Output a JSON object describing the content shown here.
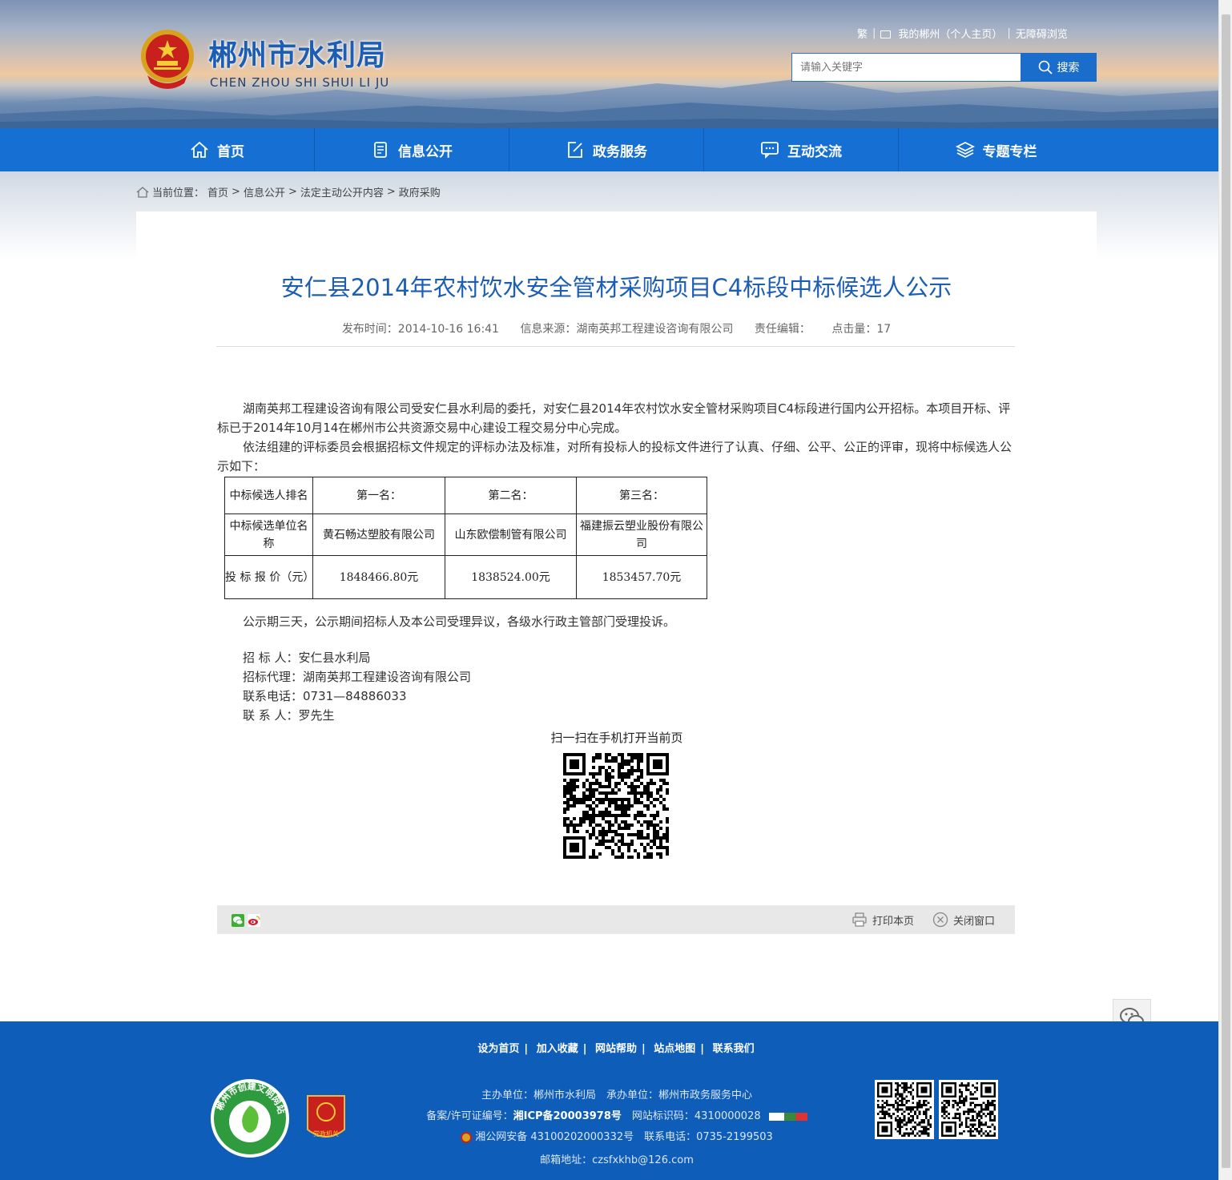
{
  "header": {
    "site_title": "郴州市水利局",
    "site_subtitle": "CHEN ZHOU SHI SHUI LI JU",
    "links": [
      "繁",
      "我的郴州（个人主页）",
      "无障碍浏览"
    ],
    "search_placeholder": "请输入关键字",
    "search_button": "搜索"
  },
  "nav": [
    {
      "label": "首页",
      "icon": "home-icon"
    },
    {
      "label": "信息公开",
      "icon": "document-icon"
    },
    {
      "label": "政务服务",
      "icon": "edit-icon"
    },
    {
      "label": "互动交流",
      "icon": "chat-icon"
    },
    {
      "label": "专题专栏",
      "icon": "layers-icon"
    }
  ],
  "breadcrumb": {
    "prefix": "当前位置：",
    "items": [
      "首页",
      "信息公开",
      "法定主动公开内容",
      "政府采购"
    ],
    "sep": ">"
  },
  "article": {
    "title": "安仁县2014年农村饮水安全管材采购项目C4标段中标候选人公示",
    "meta": {
      "publish_time": "发布时间：2014-10-16 16:41",
      "source": "信息来源：湖南英邦工程建设咨询有限公司",
      "editor": "责任编辑：",
      "clicks": "点击量：17"
    },
    "para1": "湖南英邦工程建设咨询有限公司受安仁县水利局的委托，对安仁县2014年农村饮水安全管材采购项目C4标段进行国内公开招标。本项目开标、评标已于2014年10月14在郴州市公共资源交易中心建设工程交易分中心完成。",
    "para2": "依法组建的评标委员会根据招标文件规定的评标办法及标准，对所有投标人的投标文件进行了认真、仔细、公平、公正的评审，现将中标候选人公示如下：",
    "table": {
      "rows": [
        [
          "中标候选人排名",
          "第一名：",
          "第二名：",
          "第三名："
        ],
        [
          "中标候选单位名称",
          "黄石畅达塑胶有限公司",
          "山东欧偿制管有限公司",
          "福建振云塑业股份有限公司"
        ],
        [
          "投 标 报 价（元）",
          "1848466.80元",
          "1838524.00元",
          "1853457.70元"
        ]
      ]
    },
    "para3": "公示期三天，公示期间招标人及本公司受理异议，各级水行政主管部门受理投诉。",
    "contacts": [
      "招 标 人：安仁县水利局",
      "招标代理：湖南英邦工程建设咨询有限公司",
      "联系电话：0731—84886033",
      "联 系 人：罗先生"
    ],
    "qr_caption": "扫一扫在手机打开当前页"
  },
  "share": {
    "print": "打印本页",
    "close": "关闭窗口"
  },
  "footer": {
    "links": [
      "设为首页",
      "加入收藏",
      "网站帮助",
      "站点地图",
      "联系我们"
    ],
    "host": "主办单位：郴州市水利局　承办单位：郴州市政务服务中心",
    "icp_label": "备案/许可证编号：",
    "icp_value": "湘ICP备20003978号",
    "site_id": "网站标识码：4310000028",
    "police": "湘公网安备 43100202000332号　联系电话：0735-2199503",
    "email": "邮箱地址：czsfxkhb@126.com",
    "badge1_text": "郴州市创建文明网站",
    "badge2_text": "党政机关"
  },
  "colors": {
    "primary": "#1670d4",
    "footer": "#0d5db9",
    "title": "#1d5eb5"
  }
}
